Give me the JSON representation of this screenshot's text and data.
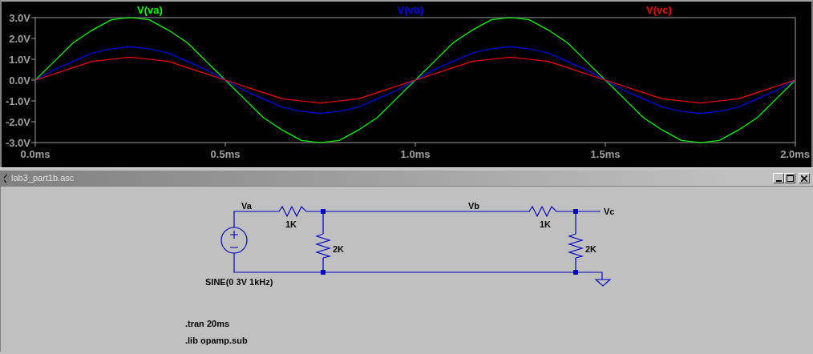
{
  "plot": {
    "chart_data": {
      "type": "line",
      "x": [
        0,
        0.05,
        0.1,
        0.15,
        0.2,
        0.25,
        0.3,
        0.35,
        0.4,
        0.45,
        0.5,
        0.55,
        0.6,
        0.65,
        0.7,
        0.75,
        0.8,
        0.85,
        0.9,
        0.95,
        1,
        1.05,
        1.1,
        1.15,
        1.2,
        1.25,
        1.3,
        1.35,
        1.4,
        1.45,
        1.5,
        1.55,
        1.6,
        1.65,
        1.7,
        1.75,
        1.8,
        1.85,
        1.9,
        1.95,
        2
      ],
      "series": [
        {
          "name": "V(va)",
          "color": "#00ff00",
          "values": [
            0,
            0.9,
            1.8,
            2.4,
            2.9,
            3,
            2.9,
            2.4,
            1.8,
            0.9,
            0,
            -0.9,
            -1.8,
            -2.4,
            -2.9,
            -3,
            -2.9,
            -2.4,
            -1.8,
            -0.9,
            0,
            0.9,
            1.8,
            2.4,
            2.9,
            3,
            2.9,
            2.4,
            1.8,
            0.9,
            0,
            -0.9,
            -1.8,
            -2.4,
            -2.9,
            -3,
            -2.9,
            -2.4,
            -1.8,
            -0.9,
            0
          ]
        },
        {
          "name": "V(vb)",
          "color": "#0000ff",
          "values": [
            0,
            0.5,
            0.9,
            1.3,
            1.5,
            1.6,
            1.5,
            1.3,
            0.9,
            0.5,
            0,
            -0.5,
            -0.9,
            -1.3,
            -1.5,
            -1.6,
            -1.5,
            -1.3,
            -0.9,
            -0.5,
            0,
            0.5,
            0.9,
            1.3,
            1.5,
            1.6,
            1.5,
            1.3,
            0.9,
            0.5,
            0,
            -0.5,
            -0.9,
            -1.3,
            -1.5,
            -1.6,
            -1.5,
            -1.3,
            -0.9,
            -0.5,
            0
          ]
        },
        {
          "name": "V(vc)",
          "color": "#ff0000",
          "values": [
            0,
            0.3,
            0.6,
            0.9,
            1,
            1.1,
            1,
            0.9,
            0.6,
            0.3,
            0,
            -0.3,
            -0.6,
            -0.9,
            -1,
            -1.1,
            -1,
            -0.9,
            -0.6,
            -0.3,
            0,
            0.3,
            0.6,
            0.9,
            1,
            1.1,
            1,
            0.9,
            0.6,
            0.3,
            0,
            -0.3,
            -0.6,
            -0.9,
            -1,
            -1.1,
            -1,
            -0.9,
            -0.6,
            -0.3,
            0
          ]
        }
      ],
      "xlim": [
        0,
        2
      ],
      "ylim": [
        -3,
        3
      ],
      "xticks": [
        {
          "value": 0,
          "label": "0.0ms"
        },
        {
          "value": 0.5,
          "label": "0.5ms"
        },
        {
          "value": 1,
          "label": "1.0ms"
        },
        {
          "value": 1.5,
          "label": "1.5ms"
        },
        {
          "value": 2,
          "label": "2.0ms"
        }
      ],
      "yticks": [
        {
          "value": 3,
          "label": "3.0V"
        },
        {
          "value": 2,
          "label": "2.0V"
        },
        {
          "value": 1,
          "label": "1.0V"
        },
        {
          "value": 0,
          "label": "0.0V"
        },
        {
          "value": -1,
          "label": "-1.0V"
        },
        {
          "value": -2,
          "label": "-2.0V"
        },
        {
          "value": -3,
          "label": "-3.0V"
        }
      ]
    }
  },
  "schematic_window": {
    "title": "lab3_part1b.asc",
    "net_labels": [
      "Va",
      "Vb",
      "Vc"
    ],
    "resistors": [
      {
        "value": "1K"
      },
      {
        "value": "2K"
      },
      {
        "value": "1K"
      },
      {
        "value": "2K"
      }
    ],
    "source": {
      "value": "SINE(0 3V 1kHz)"
    },
    "directives": [
      ".tran 20ms",
      ".lib opamp.sub"
    ]
  }
}
